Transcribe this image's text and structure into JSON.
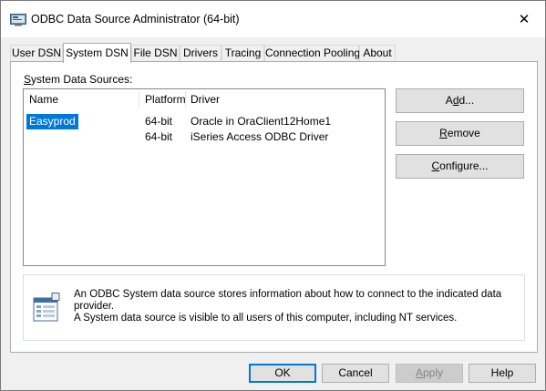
{
  "window": {
    "title": "ODBC Data Source Administrator (64-bit)",
    "close_glyph": "✕"
  },
  "tabs": [
    {
      "label": "User DSN",
      "active": false
    },
    {
      "label": "System DSN",
      "active": true
    },
    {
      "label": "File DSN",
      "active": false
    },
    {
      "label": "Drivers",
      "active": false
    },
    {
      "label": "Tracing",
      "active": false
    },
    {
      "label": "Connection Pooling",
      "active": false
    },
    {
      "label": "About",
      "active": false
    }
  ],
  "panel": {
    "section_label": {
      "before": "",
      "mnemonic": "S",
      "after": "ystem Data Sources:"
    },
    "columns": [
      "Name",
      "Platform",
      "Driver"
    ],
    "rows": [
      {
        "name": "Easyprod",
        "platform": "64-bit",
        "driver": "Oracle in OraClient12Home1",
        "selected": true
      },
      {
        "name": "",
        "platform": "64-bit",
        "driver": "iSeries Access ODBC Driver",
        "selected": false
      }
    ],
    "buttons": {
      "add": {
        "before": "A",
        "mnemonic": "d",
        "after": "d..."
      },
      "remove": {
        "before": "",
        "mnemonic": "R",
        "after": "emove"
      },
      "configure": {
        "before": "",
        "mnemonic": "C",
        "after": "onfigure..."
      }
    },
    "info": {
      "icon": "data-source-document-icon",
      "line1": "An ODBC System data source stores information about how to connect to the indicated data provider.",
      "line2": "A System data source is visible to all users of this computer, including NT services."
    }
  },
  "footer": {
    "ok": "OK",
    "cancel": "Cancel",
    "apply": {
      "before": "",
      "mnemonic": "A",
      "after": "pply"
    },
    "help": "Help"
  },
  "colors": {
    "selection": "#0078d7",
    "default_button_border": "#0078d7",
    "window_bg": "#f0f0f0"
  }
}
